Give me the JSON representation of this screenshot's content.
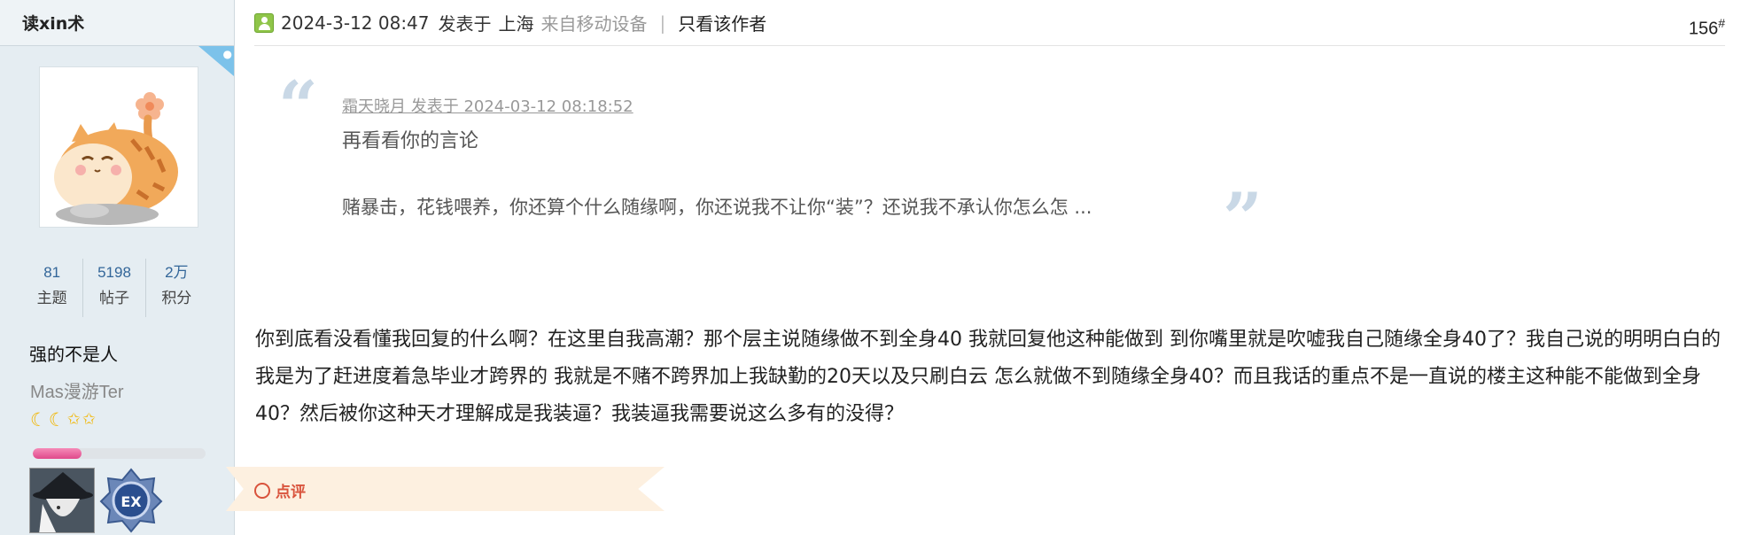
{
  "author": {
    "name": "读xin术",
    "stats": [
      {
        "value": "81",
        "label": "主题"
      },
      {
        "value": "5198",
        "label": "帖子"
      },
      {
        "value": "2万",
        "label": "积分"
      }
    ],
    "title": "强的不是人",
    "group": "Mas漫游Ter",
    "stars_icons": [
      "moon-icon",
      "moon-icon",
      "star-icon",
      "star-icon"
    ],
    "progress_percent": 28
  },
  "post": {
    "date": "2024-3-12 08:47",
    "posted_in": "发表于",
    "location": "上海",
    "device": "来自移动设备",
    "separator": "|",
    "only_author": "只看该作者",
    "floor": "156",
    "floor_mark": "#",
    "quote": {
      "meta": "霜天晓月 发表于 2024-03-12 08:18:52",
      "line1": "再看看你的言论",
      "line2": "赌暴击，花钱喂养，你还算个什么随缘啊，你还说我不让你“装”？还说我不承认你怎么怎 ..."
    },
    "body": "你到底看没看懂我回复的什么啊？在这里自我高潮？那个层主说随缘做不到全身40  我就回复他这种能做到  到你嘴里就是吹嘘我自己随缘全身40了？我自己说的明明白白的我是为了赶进度着急毕业才跨界的 我就是不赌不跨界加上我缺勤的20天以及只刷白云  怎么就做不到随缘全身40？而且我话的重点不是一直说的楼主这种能不能做到全身40？然后被你这种天才理解成是我装逼？我装逼我需要说这么多有的没得？",
    "comment_label": "点评"
  },
  "colors": {
    "sidebar_bg": "#e5edf2",
    "link_blue": "#336699",
    "progress_pink": "#e0498b",
    "comment_red": "#d9533c"
  }
}
